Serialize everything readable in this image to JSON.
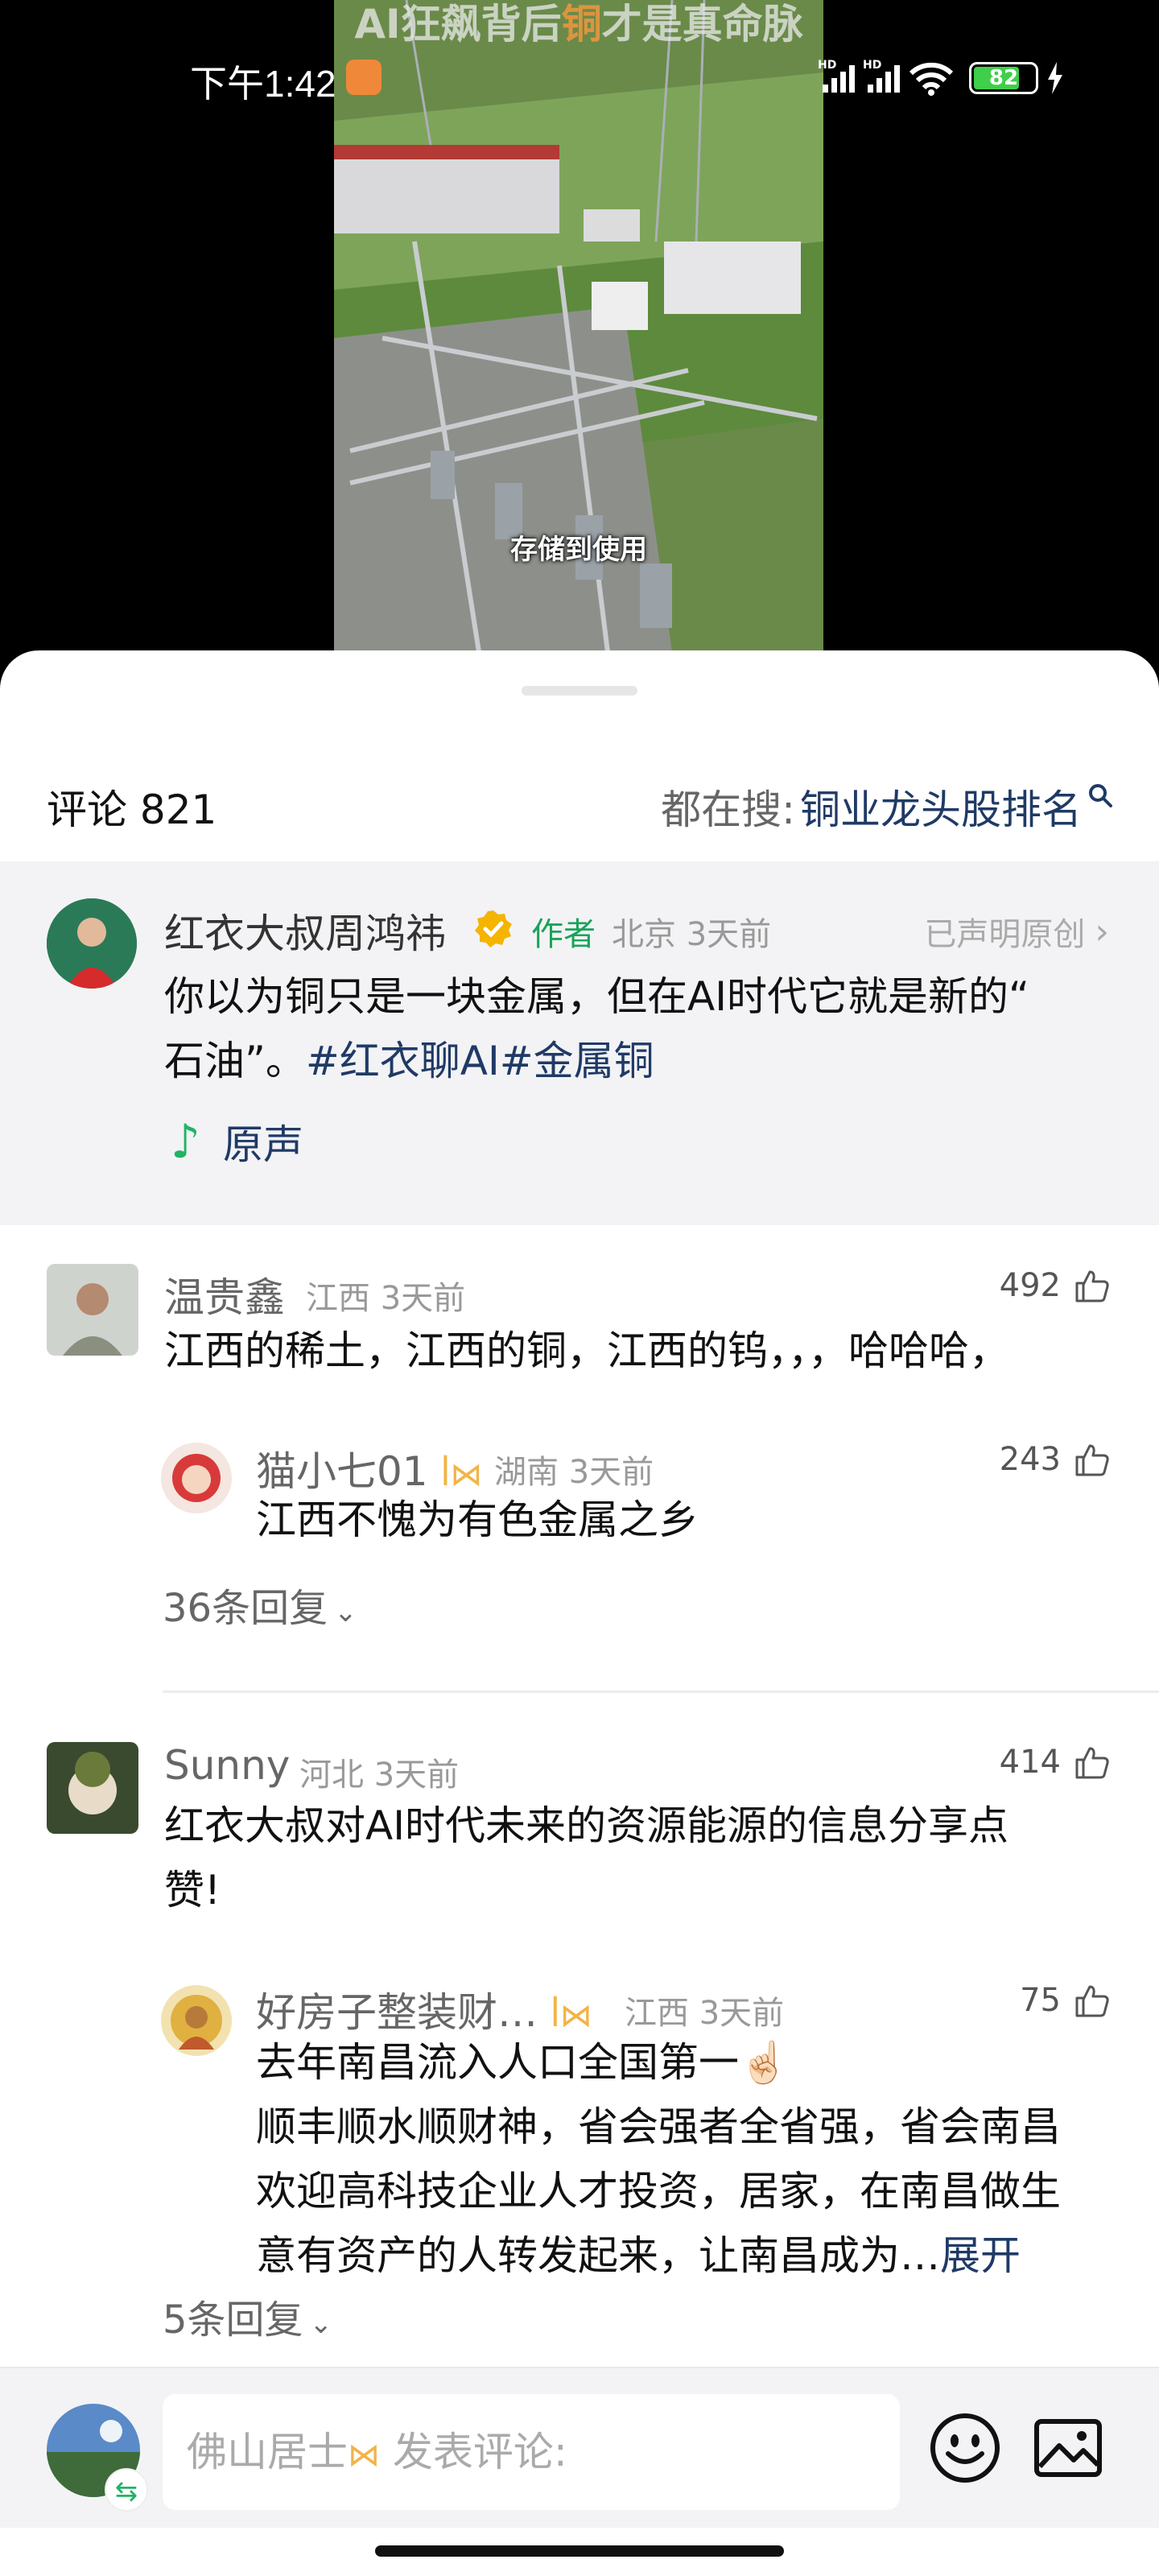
{
  "status_bar": {
    "time": "下午1:42",
    "battery": "82"
  },
  "video": {
    "top_caption_parts": [
      "AI狂飙背后",
      "铜",
      "才是真命脉"
    ],
    "subtitle": "存储到使用"
  },
  "header": {
    "title": "评论 821",
    "search_prefix": "都在搜:",
    "search_keyword": "铜业龙头股排名"
  },
  "author_post": {
    "name": "红衣大叔周鸿祎",
    "author_tag": "作者",
    "meta": "北京 3天前",
    "original_claim": "已声明原创",
    "text_line1": "你以为铜只是一块金属，但在AI时代它就是新的“",
    "text_line2_prefix": "石油”。",
    "hashtags": "#红衣聊AI#金属铜",
    "music_label": "原声"
  },
  "comments": [
    {
      "name": "温贵鑫",
      "meta": "江西 3天前",
      "likes": "492",
      "text": "江西的稀土，江西的铜，江西的钨，，，哈哈哈，",
      "reply": {
        "name": "猫小七01",
        "meta": "湖南 3天前",
        "likes": "243",
        "text": "江西不愧为有色金属之乡"
      },
      "replies_toggle": "36条回复"
    },
    {
      "name": "Sunny",
      "meta": "河北 3天前",
      "likes": "414",
      "text_line1": "红衣大叔对AI时代未来的资源能源的信息分享点",
      "text_line2": "赞!",
      "reply": {
        "name": "好房子整装财…",
        "meta": "江西 3天前",
        "likes": "75",
        "line1": "去年南昌流入人口全国第一☝🏻",
        "line2": "顺丰顺水顺财神，省会强者全省强，省会南昌",
        "line3": "欢迎高科技企业人才投资，居家，在南昌做生",
        "line4": "意有资产的人转发起来，让南昌成为…",
        "expand": "展开"
      },
      "replies_toggle": "5条回复"
    }
  ],
  "input_bar": {
    "user_name": "佛山居士",
    "placeholder": "发表评论:"
  },
  "icons": [
    "search-icon",
    "verified-icon",
    "music-note-icon",
    "thumbs-up-icon",
    "chevron-down-icon",
    "chevron-right-icon",
    "emoji-icon",
    "image-icon",
    "switch-account-icon"
  ],
  "colors": {
    "link": "#1f3a66",
    "author_tag": "#1aa35a",
    "badge": "#f2b447",
    "battery": "#3fcf4a"
  }
}
